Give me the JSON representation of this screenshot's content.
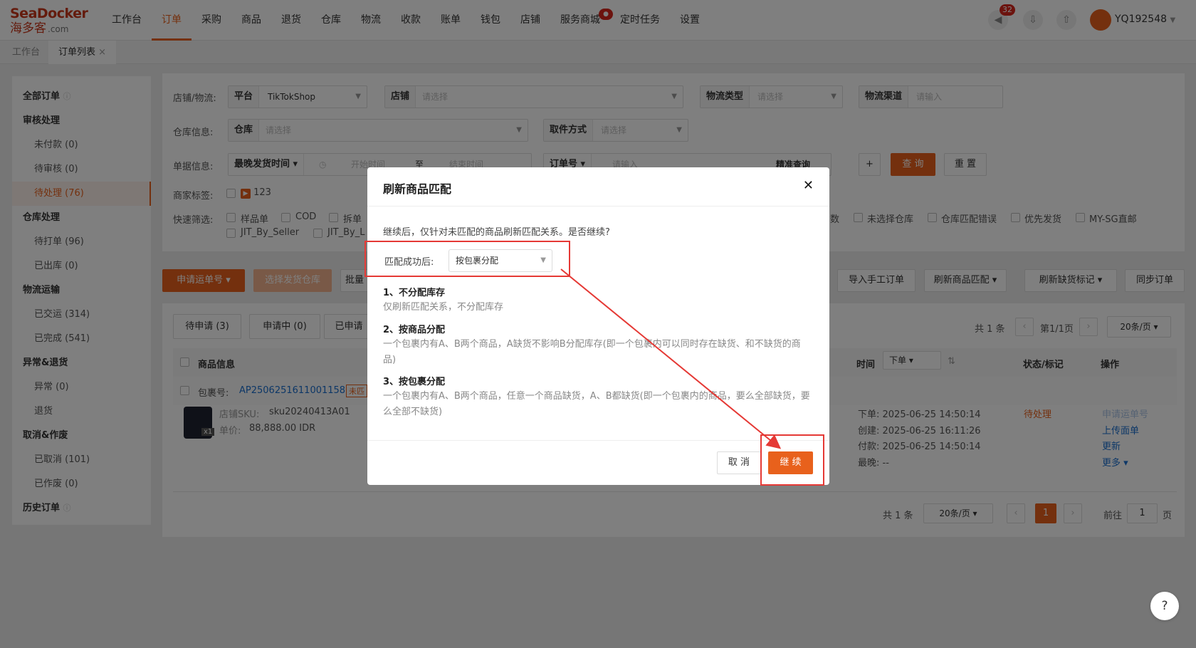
{
  "brand": {
    "line1": "SeaDocker",
    "line2": "海多客",
    "suffix": ".com"
  },
  "nav": [
    "工作台",
    "订单",
    "采购",
    "商品",
    "退货",
    "仓库",
    "物流",
    "收款",
    "账单",
    "钱包",
    "店铺",
    "服务商城",
    "定时任务",
    "设置"
  ],
  "nav_active": "订单",
  "notifications": {
    "count": "32"
  },
  "user": {
    "name": "YQ192548"
  },
  "tabs": {
    "home": "工作台",
    "orders": "订单列表",
    "close": "×"
  },
  "sidebar": {
    "all": "全部订单",
    "groups": [
      {
        "title": "审核处理",
        "items": [
          "未付款 (0)",
          "待审核 (0)",
          "待处理 (76)"
        ]
      },
      {
        "title": "仓库处理",
        "items": [
          "待打单 (96)",
          "已出库 (0)"
        ]
      },
      {
        "title": "物流运输",
        "items": [
          "已交运 (314)",
          "已完成 (541)"
        ]
      },
      {
        "title": "异常&退货",
        "items": [
          "异常 (0)",
          "退货"
        ]
      },
      {
        "title": "取消&作废",
        "items": [
          "已取消 (101)",
          "已作废 (0)"
        ]
      }
    ],
    "history": "历史订单"
  },
  "filters": {
    "row1_label": "店铺/物流:",
    "platform_label": "平台",
    "platform_value": "TikTokShop",
    "store_label": "店铺",
    "store_ph": "请选择",
    "logistics_type_label": "物流类型",
    "logistics_type_ph": "请选择",
    "channel_label": "物流渠道",
    "channel_ph": "请输入",
    "row2_label": "仓库信息:",
    "warehouse_label": "仓库",
    "warehouse_ph": "请选择",
    "pickup_label": "取件方式",
    "pickup_ph": "请选择",
    "row3_label": "单据信息:",
    "time_type": "最晚发货时间",
    "start_ph": "开始时间",
    "to": "至",
    "end_ph": "结束时间",
    "order_no": "订单号",
    "input_ph": "请输入",
    "exact": "精准查询",
    "plus": "+",
    "query": "查 询",
    "reset": "重 置",
    "row4_label": "商家标签:",
    "tag_value": "123",
    "row5_label": "快速筛选:",
    "quick": [
      "样品单",
      "COD",
      "拆单",
      "JIT_By_Seller",
      "JIT_By_L"
    ],
    "quick_right": [
      "数",
      "未选择仓库",
      "仓库匹配错误",
      "优先发货",
      "MY-SG直邮"
    ]
  },
  "actions": {
    "apply_waybill": "申请运单号",
    "select_warehouse": "选择发货仓库",
    "batch": "批量",
    "import_manual": "导入手工订单",
    "refresh_match": "刷新商品匹配",
    "refresh_shortage": "刷新缺货标记",
    "sync": "同步订单"
  },
  "list": {
    "tabs": [
      "待申请 (3)",
      "申请中 (0)",
      "已申请"
    ],
    "total": "共 1 条",
    "page": "第1/1页",
    "page_size": "20条/页",
    "col_product": "商品信息",
    "col_time": "时间",
    "time_sort": "下单",
    "col_status": "状态/标记",
    "col_ops": "操作",
    "pkg_label": "包裹号:",
    "pkg_no": "AP2506251611001158",
    "pkg_tag": "未匹",
    "sku_label": "店铺SKU:",
    "sku": "sku20240413A01",
    "price_label": "单价:",
    "price": "88,888.00 IDR",
    "qty": "x1",
    "times": [
      "下单: 2025-06-25 14:50:14",
      "创建: 2025-06-25 16:11:26",
      "付款: 2025-06-25 14:50:14",
      "最晚: --"
    ],
    "status": "待处理",
    "ops": [
      "申请运单号",
      "上传面单",
      "更新",
      "更多"
    ]
  },
  "pager": {
    "total": "共 1 条",
    "size": "20条/页",
    "current": "1",
    "goto": "前往",
    "goto_value": "1",
    "page_unit": "页"
  },
  "modal": {
    "title": "刷新商品匹配",
    "close": "✕",
    "intro": "继续后，仅针对未匹配的商品刷新匹配关系。是否继续?",
    "field_label": "匹配成功后:",
    "field_value": "按包裹分配",
    "options": [
      {
        "title": "1、不分配库存",
        "desc": "仅刷新匹配关系，不分配库存"
      },
      {
        "title": "2、按商品分配",
        "desc": "一个包裹内有A、B两个商品，A缺货不影响B分配库存(即一个包裹内可以同时存在缺货、和不缺货的商品)"
      },
      {
        "title": "3、按包裹分配",
        "desc": "一个包裹内有A、B两个商品，任意一个商品缺货，A、B都缺货(即一个包裹内的商品，要么全部缺货，要么全部不缺货)"
      }
    ],
    "cancel": "取 消",
    "confirm": "继 续"
  },
  "help": "?",
  "colors": {
    "accent": "#e8611c",
    "annotation": "#e53935"
  }
}
